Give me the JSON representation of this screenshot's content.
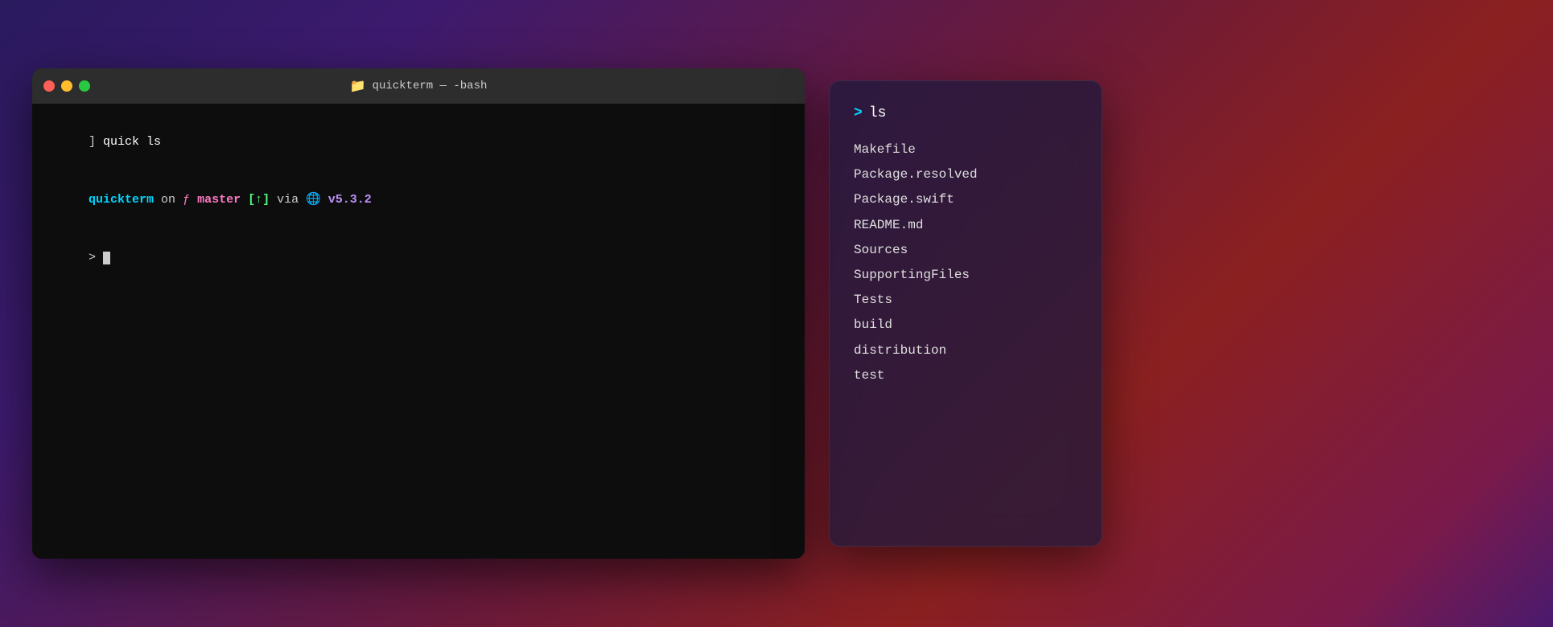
{
  "background": {
    "gradient_description": "dark purple to red gradient"
  },
  "terminal": {
    "title": "quickterm — -bash",
    "controls": {
      "close": "close",
      "minimize": "minimize",
      "maximize": "maximize"
    },
    "title_icon": "📁",
    "lines": [
      {
        "type": "history",
        "content": "] quick ls"
      },
      {
        "type": "prompt_info",
        "quickterm": "quickterm",
        "on_text": " on ",
        "branch_icon": "ƒ",
        "branch": " master ",
        "modified": "[↑]",
        "via_text": " via ",
        "swift_emoji": "🌐",
        "swift_version": " v5.3.2"
      },
      {
        "type": "prompt",
        "cursor": true
      }
    ]
  },
  "panel": {
    "command": "ls",
    "files": [
      "Makefile",
      "Package.resolved",
      "Package.swift",
      "README.md",
      "Sources",
      "SupportingFiles",
      "Tests",
      "build",
      "distribution",
      "test"
    ]
  }
}
